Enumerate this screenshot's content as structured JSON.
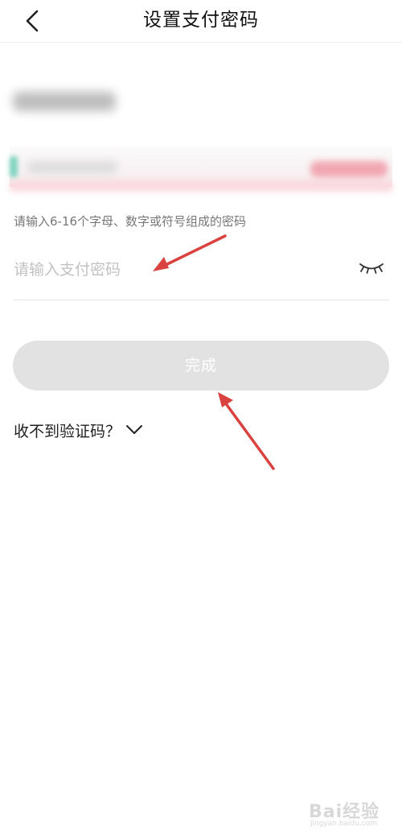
{
  "header": {
    "title": "设置支付密码",
    "back_icon": "chevron-left-icon"
  },
  "form": {
    "hint": "请输入6-16个字母、数字或符号组成的密码",
    "password_placeholder": "请输入支付密码",
    "password_value": "",
    "eye_icon": "eye-closed-icon"
  },
  "actions": {
    "done_label": "完成",
    "no_code_label": "收不到验证码？",
    "no_code_icon": "chevron-down-icon"
  },
  "colors": {
    "annotation_arrow": "#d9423f",
    "done_button_bg": "#e2e2e2",
    "placeholder": "#c2c2c2"
  },
  "watermark": {
    "logo": "Bai经验",
    "sub": "jingyan.baidu.com"
  }
}
